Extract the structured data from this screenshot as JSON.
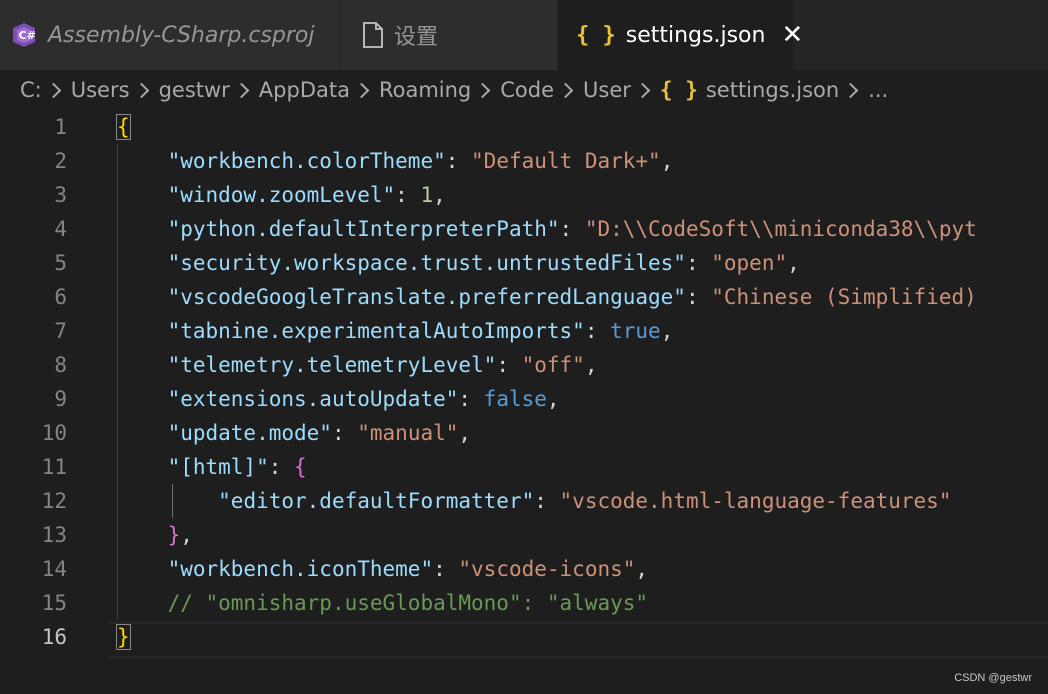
{
  "tabs": [
    {
      "title": "Assembly-CSharp.csproj",
      "icon": "csharp-project-icon",
      "italic": true
    },
    {
      "title": "设置",
      "icon": "file-icon"
    },
    {
      "title": "settings.json",
      "icon": "json-braces-icon",
      "active": true,
      "close": "✕"
    }
  ],
  "breadcrumb": {
    "items": [
      "C:",
      "Users",
      "gestwr",
      "AppData",
      "Roaming",
      "Code",
      "User"
    ],
    "file_icon": "{ }",
    "file": "settings.json",
    "ellipsis": "..."
  },
  "editor": {
    "current_line": 16,
    "lines": [
      {
        "n": "1",
        "tokens": [
          {
            "t": "{",
            "c": "br1"
          }
        ]
      },
      {
        "n": "2",
        "tokens": [
          {
            "t": "    "
          },
          {
            "t": "\"workbench.colorTheme\"",
            "c": "k"
          },
          {
            "t": ": ",
            "c": "p"
          },
          {
            "t": "\"Default Dark+\"",
            "c": "s"
          },
          {
            "t": ",",
            "c": "p"
          }
        ]
      },
      {
        "n": "3",
        "tokens": [
          {
            "t": "    "
          },
          {
            "t": "\"window.zoomLevel\"",
            "c": "k"
          },
          {
            "t": ": ",
            "c": "p"
          },
          {
            "t": "1",
            "c": "n"
          },
          {
            "t": ",",
            "c": "p"
          }
        ]
      },
      {
        "n": "4",
        "tokens": [
          {
            "t": "    "
          },
          {
            "t": "\"python.defaultInterpreterPath\"",
            "c": "k"
          },
          {
            "t": ": ",
            "c": "p"
          },
          {
            "t": "\"D:\\\\CodeSoft\\\\miniconda38\\\\pyt",
            "c": "s"
          }
        ]
      },
      {
        "n": "5",
        "tokens": [
          {
            "t": "    "
          },
          {
            "t": "\"security.workspace.trust.untrustedFiles\"",
            "c": "k"
          },
          {
            "t": ": ",
            "c": "p"
          },
          {
            "t": "\"open\"",
            "c": "s"
          },
          {
            "t": ",",
            "c": "p"
          }
        ]
      },
      {
        "n": "6",
        "tokens": [
          {
            "t": "    "
          },
          {
            "t": "\"vscodeGoogleTranslate.preferredLanguage\"",
            "c": "k"
          },
          {
            "t": ": ",
            "c": "p"
          },
          {
            "t": "\"Chinese (Simplified)",
            "c": "s"
          }
        ]
      },
      {
        "n": "7",
        "tokens": [
          {
            "t": "    "
          },
          {
            "t": "\"tabnine.experimentalAutoImports\"",
            "c": "k"
          },
          {
            "t": ": ",
            "c": "p"
          },
          {
            "t": "true",
            "c": "b"
          },
          {
            "t": ",",
            "c": "p"
          }
        ]
      },
      {
        "n": "8",
        "tokens": [
          {
            "t": "    "
          },
          {
            "t": "\"telemetry.telemetryLevel\"",
            "c": "k"
          },
          {
            "t": ": ",
            "c": "p"
          },
          {
            "t": "\"off\"",
            "c": "s"
          },
          {
            "t": ",",
            "c": "p"
          }
        ]
      },
      {
        "n": "9",
        "tokens": [
          {
            "t": "    "
          },
          {
            "t": "\"extensions.autoUpdate\"",
            "c": "k"
          },
          {
            "t": ": ",
            "c": "p"
          },
          {
            "t": "false",
            "c": "b"
          },
          {
            "t": ",",
            "c": "p"
          }
        ]
      },
      {
        "n": "10",
        "tokens": [
          {
            "t": "    "
          },
          {
            "t": "\"update.mode\"",
            "c": "k"
          },
          {
            "t": ": ",
            "c": "p"
          },
          {
            "t": "\"manual\"",
            "c": "s"
          },
          {
            "t": ",",
            "c": "p"
          }
        ]
      },
      {
        "n": "11",
        "tokens": [
          {
            "t": "    "
          },
          {
            "t": "\"[html]\"",
            "c": "k"
          },
          {
            "t": ": ",
            "c": "p"
          },
          {
            "t": "{",
            "c": "br2"
          }
        ]
      },
      {
        "n": "12",
        "tokens": [
          {
            "t": "        "
          },
          {
            "t": "\"editor.defaultFormatter\"",
            "c": "k"
          },
          {
            "t": ": ",
            "c": "p"
          },
          {
            "t": "\"vscode.html-language-features\"",
            "c": "s"
          }
        ]
      },
      {
        "n": "13",
        "tokens": [
          {
            "t": "    "
          },
          {
            "t": "}",
            "c": "br2"
          },
          {
            "t": ",",
            "c": "p"
          }
        ]
      },
      {
        "n": "14",
        "tokens": [
          {
            "t": "    "
          },
          {
            "t": "\"workbench.iconTheme\"",
            "c": "k"
          },
          {
            "t": ": ",
            "c": "p"
          },
          {
            "t": "\"vscode-icons\"",
            "c": "s"
          },
          {
            "t": ",",
            "c": "p"
          }
        ]
      },
      {
        "n": "15",
        "tokens": [
          {
            "t": "    "
          },
          {
            "t": "// \"omnisharp.useGlobalMono\": \"always\"",
            "c": "c"
          }
        ]
      },
      {
        "n": "16",
        "tokens": [
          {
            "t": "}",
            "c": "br1"
          }
        ]
      }
    ]
  },
  "watermark": "CSDN @gestwr"
}
